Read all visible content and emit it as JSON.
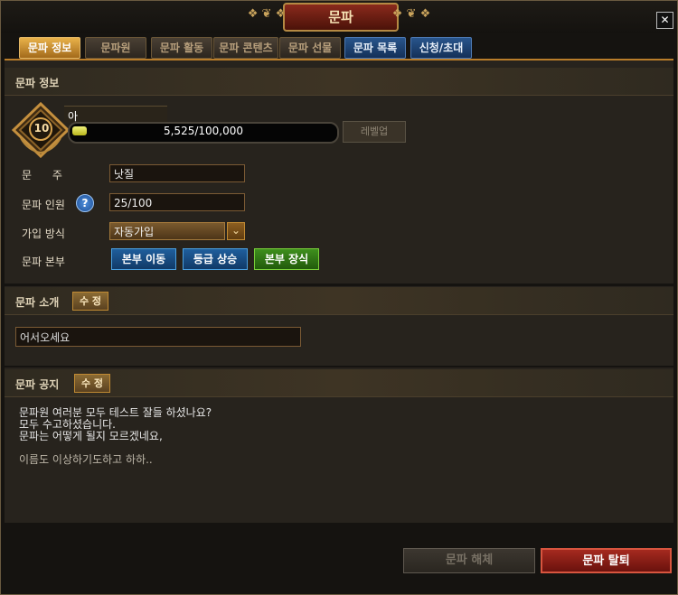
{
  "window": {
    "title": "문파",
    "close_glyph": "✕"
  },
  "tabs": [
    {
      "label": "문파 정보",
      "style": "active"
    },
    {
      "label": "문파원",
      "style": "normal"
    },
    {
      "label": "문파 활동",
      "style": "normal"
    },
    {
      "label": "문파 콘텐츠",
      "style": "normal"
    },
    {
      "label": "문파 선물",
      "style": "normal"
    },
    {
      "label": "문파 목록",
      "style": "blue"
    },
    {
      "label": "신청/초대",
      "style": "blue"
    }
  ],
  "info": {
    "header": "문파 정보",
    "guild_name": "아",
    "level": "10",
    "exp_text": "5,525/100,000",
    "exp_progress": 0.05525,
    "levelup_label": "레벨업",
    "rows": [
      {
        "label": "문      주",
        "value": "낫질"
      },
      {
        "label": "문파 인원",
        "value": "25/100"
      },
      {
        "label": "가입 방식",
        "value": "자동가입"
      },
      {
        "label": "문파 본부"
      }
    ],
    "help_glyph": "?",
    "dropdown_glyph": "⌄",
    "hq_buttons": {
      "move": "본부 이동",
      "upgrade": "등급 상승",
      "decorate": "본부 장식"
    }
  },
  "intro": {
    "header": "문파 소개",
    "edit_label": "수 정",
    "text": "어서오세요"
  },
  "notice": {
    "header": "문파 공지",
    "edit_label": "수 정",
    "lines": [
      "문파원 여러분 모두 테스트 잘들 하셨나요?",
      "모두 수고하셨습니다.",
      "문파는 어떻게 될지 모르겠네요,"
    ],
    "extra": "이름도 이상하기도하고 하하.."
  },
  "footer": {
    "disband_label": "문파 해체",
    "leave_label": "문파 탈퇴"
  },
  "colors": {
    "accent": "#e9b24a",
    "blue_tab": "#28558c",
    "green_button": "#3e8f1d",
    "leave_button": "#8f1a1a"
  }
}
